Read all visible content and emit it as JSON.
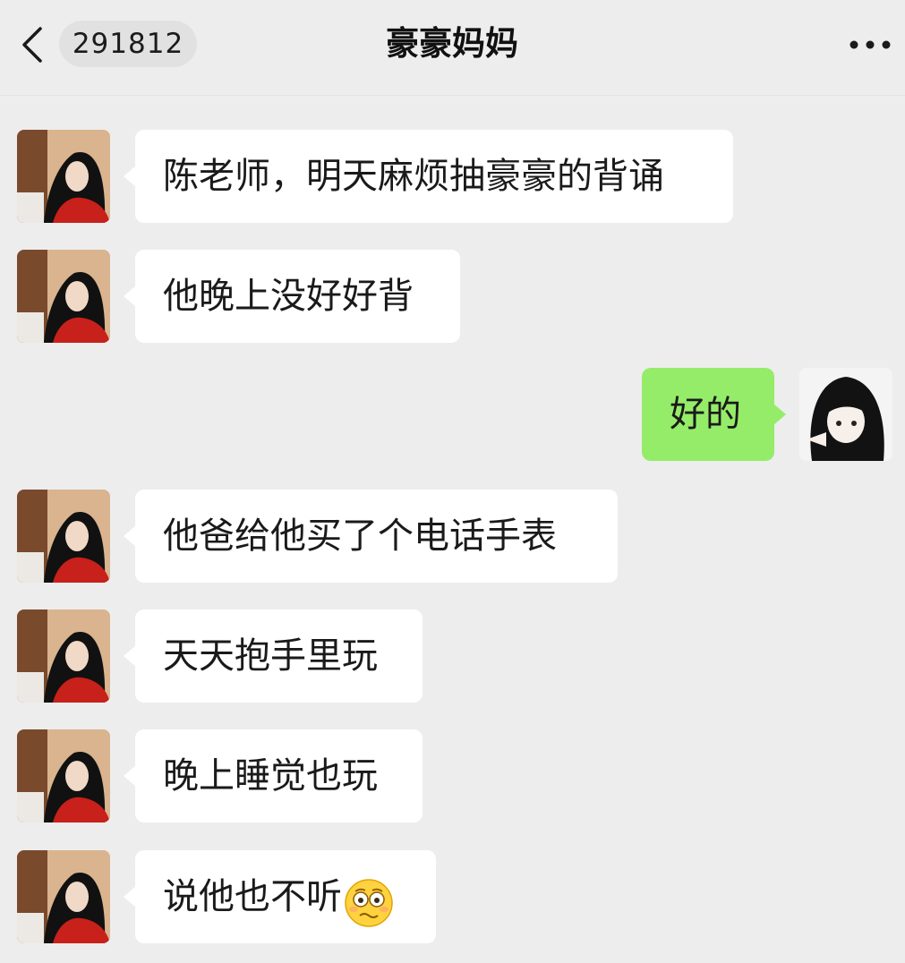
{
  "header": {
    "unread_count": "291812",
    "chat_title": "豪豪妈妈"
  },
  "messages": [
    {
      "sender": "contact",
      "text": "陈老师，明天麻烦抽豪豪的背诵"
    },
    {
      "sender": "contact",
      "text": "他晚上没好好背"
    },
    {
      "sender": "me",
      "text": "好的"
    },
    {
      "sender": "contact",
      "text": "他爸给他买了个电话手表"
    },
    {
      "sender": "contact",
      "text": "天天抱手里玩"
    },
    {
      "sender": "contact",
      "text": "晚上睡觉也玩"
    },
    {
      "sender": "contact",
      "text": "说他也不听",
      "emoji": "flushed-face-emoji"
    }
  ],
  "colors": {
    "background": "#ededed",
    "incoming_bubble": "#ffffff",
    "outgoing_bubble": "#95ec69"
  }
}
